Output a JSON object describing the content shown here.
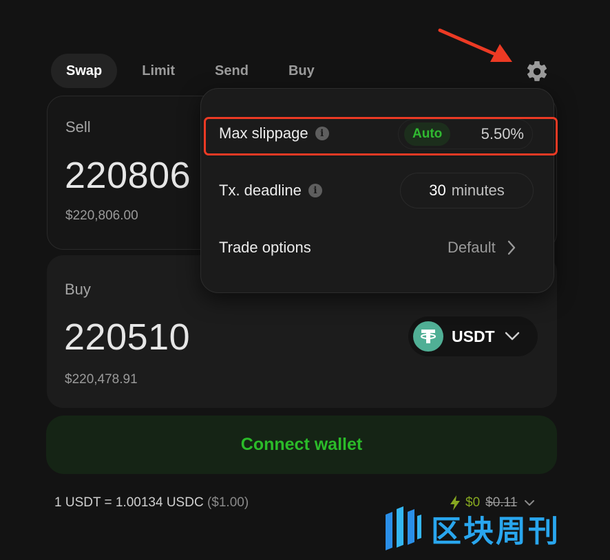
{
  "tabs": [
    {
      "label": "Swap",
      "active": true
    },
    {
      "label": "Limit"
    },
    {
      "label": "Send"
    },
    {
      "label": "Buy"
    }
  ],
  "sell": {
    "label": "Sell",
    "amount": "220806",
    "fiat": "$220,806.00"
  },
  "buy": {
    "label": "Buy",
    "amount": "220510",
    "fiat": "$220,478.91",
    "token": "USDT"
  },
  "connect_label": "Connect wallet",
  "rate": {
    "text": "1 USDT = 1.00134 USDC",
    "fiat": "($1.00)"
  },
  "gas": {
    "current": "$0",
    "original": "$0.11"
  },
  "settings": {
    "max_slippage_label": "Max slippage",
    "auto_label": "Auto",
    "slippage_value": "5.50%",
    "deadline_label": "Tx. deadline",
    "deadline_value": "30",
    "deadline_unit": "minutes",
    "trade_options_label": "Trade options",
    "trade_options_value": "Default"
  },
  "watermark": "区块周刊",
  "colors": {
    "background": "#131313",
    "accent_green": "#2bbb29",
    "annotation_red": "#ec3a24",
    "usdt_green": "#50af95",
    "watermark_blue": "#29a6ee"
  },
  "icons": [
    "gear-icon",
    "info-icon",
    "chevron-down-icon",
    "chevron-right-icon",
    "usdt-logo",
    "lightning-icon"
  ]
}
